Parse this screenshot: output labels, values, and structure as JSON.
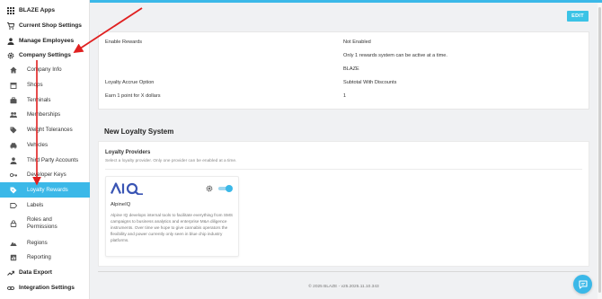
{
  "sidebar": {
    "top_items": [
      {
        "label": "BLAZE Apps",
        "icon": "apps-grid-icon"
      },
      {
        "label": "Current Shop Settings",
        "icon": "cart-icon"
      },
      {
        "label": "Manage Employees",
        "icon": "person-icon"
      },
      {
        "label": "Company Settings",
        "icon": "gear-icon"
      }
    ],
    "sub_items": [
      {
        "label": "Company Info",
        "icon": "home-icon"
      },
      {
        "label": "Shops",
        "icon": "shop-icon"
      },
      {
        "label": "Terminals",
        "icon": "briefcase-icon"
      },
      {
        "label": "Memberships",
        "icon": "people-icon"
      },
      {
        "label": "Weight Tolerances",
        "icon": "tag-icon"
      },
      {
        "label": "Vehicles",
        "icon": "car-icon"
      },
      {
        "label": "Third Party Accounts",
        "icon": "person-icon"
      },
      {
        "label": "Developer Keys",
        "icon": "key-icon"
      },
      {
        "label": "Loyalty Rewards",
        "icon": "loyalty-tag-icon"
      },
      {
        "label": "Labels",
        "icon": "label-icon"
      },
      {
        "label": "Roles and Permissions",
        "icon": "lock-icon"
      },
      {
        "label": "Regions",
        "icon": "terrain-icon"
      },
      {
        "label": "Reporting",
        "icon": "report-icon"
      }
    ],
    "bottom_items": [
      {
        "label": "Data Export",
        "icon": "trending-icon"
      },
      {
        "label": "Integration Settings",
        "icon": "link-icon"
      }
    ],
    "active_item": "Loyalty Rewards"
  },
  "toolbar": {
    "edit_label": "EDIT"
  },
  "settings": {
    "rows": [
      {
        "label": "Enable Rewards",
        "value": "Not Enabled"
      },
      {
        "label": "",
        "value": "Only 1 rewards system can be active at a time."
      },
      {
        "label": "",
        "value": "BLAZE"
      },
      {
        "label": "Loyalty Accrue Option",
        "value": "Subtotal With Discounts"
      },
      {
        "label": "Earn 1 point for X dollars",
        "value": "1"
      }
    ]
  },
  "loyalty": {
    "section_title": "New Loyalty System",
    "providers_title": "Loyalty Providers",
    "providers_subtitle": "Select a loyalty provider. Only one provider can be enabled at a time.",
    "provider": {
      "logo_text": "AIQ",
      "name": "AlpineIQ",
      "description": "Alpine IQ develops internal tools to facilitate everything from SMS campaigns to business analytics and enterprise M&A diligence instruments. Over time we hope to give cannabis operators the flexibility and power currently only seen in blue chip industry platforms.",
      "enabled": true
    }
  },
  "footer": {
    "text": "© 2025 BLAZE - v25.2025.11.10.343"
  },
  "colors": {
    "accent": "#3bb8e8",
    "annotation_arrow": "#e02020"
  }
}
